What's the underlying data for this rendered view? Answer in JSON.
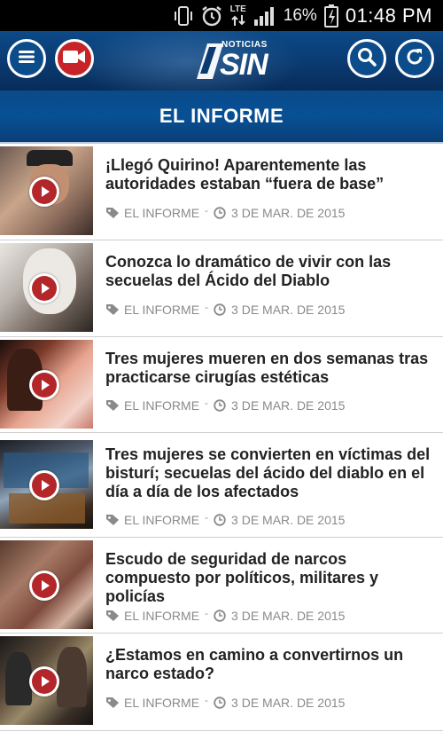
{
  "status_bar": {
    "battery": "16%",
    "time": "01:48 PM",
    "network": "LTE"
  },
  "header": {
    "logo_small": "NOTICIAS",
    "logo_big": "SIN"
  },
  "section": {
    "title": "EL INFORME"
  },
  "articles": [
    {
      "title": "¡Llegó Quirino! Aparentemente las autoridades estaban “fuera de base”",
      "category": "EL INFORME",
      "date": "3 DE MAR. DE 2015"
    },
    {
      "title": "Conozca lo dramático de vivir con las secuelas del Ácido del Diablo",
      "category": "EL INFORME",
      "date": "3 DE MAR. DE 2015"
    },
    {
      "title": "Tres mujeres mueren en dos semanas tras practicarse cirugías estéticas",
      "category": "EL INFORME",
      "date": "3 DE MAR. DE 2015"
    },
    {
      "title": "Tres mujeres se convierten en víctimas del bisturí; secuelas del ácido del diablo en el día a día de los afectados",
      "category": "EL INFORME",
      "date": "3 DE MAR. DE 2015"
    },
    {
      "title": "Escudo de seguridad de narcos compuesto por políticos, militares y policías",
      "category": "EL INFORME",
      "date": "3 DE MAR. DE 2015"
    },
    {
      "title": "¿Estamos en camino a convertirnos un narco estado?",
      "category": "EL INFORME",
      "date": "3 DE MAR. DE 2015"
    }
  ],
  "colors": {
    "header_blue": "#0a3a70",
    "accent_red": "#c62428",
    "play_red": "#b3262a"
  }
}
